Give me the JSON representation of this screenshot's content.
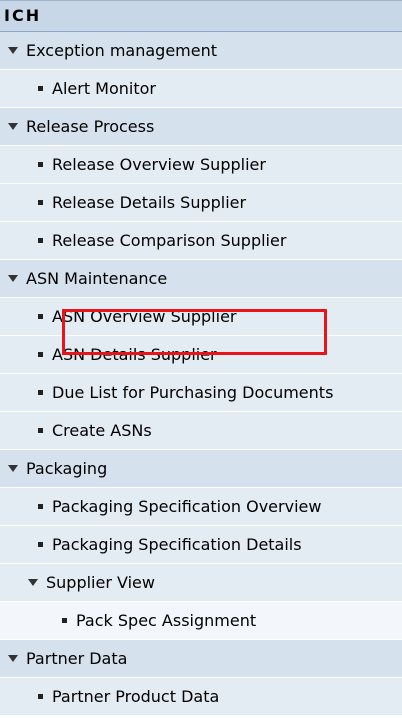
{
  "header": {
    "title": "ICH"
  },
  "menu": [
    {
      "kind": "group",
      "label": "Exception management"
    },
    {
      "kind": "item",
      "label": "Alert Monitor"
    },
    {
      "kind": "group",
      "label": "Release Process"
    },
    {
      "kind": "item",
      "label": "Release Overview Supplier"
    },
    {
      "kind": "item",
      "label": "Release Details Supplier"
    },
    {
      "kind": "item",
      "label": "Release Comparison Supplier"
    },
    {
      "kind": "group",
      "label": "ASN Maintenance"
    },
    {
      "kind": "item",
      "label": "ASN Overview Supplier"
    },
    {
      "kind": "item",
      "label": "ASN Details Supplier"
    },
    {
      "kind": "item",
      "label": "Due List for Purchasing Documents"
    },
    {
      "kind": "item",
      "label": "Create ASNs"
    },
    {
      "kind": "group",
      "label": "Packaging"
    },
    {
      "kind": "item",
      "label": "Packaging Specification Overview"
    },
    {
      "kind": "item",
      "label": "Packaging Specification Details"
    },
    {
      "kind": "subgroup",
      "label": "Supplier View"
    },
    {
      "kind": "subitem",
      "label": "Pack Spec Assignment",
      "selected": true
    },
    {
      "kind": "group",
      "label": "Partner Data"
    },
    {
      "kind": "item",
      "label": "Partner Product Data"
    }
  ],
  "colors": {
    "highlight": "#e8141a",
    "group_bg": "#d5e1ec",
    "item_bg": "#e3ebf3"
  }
}
